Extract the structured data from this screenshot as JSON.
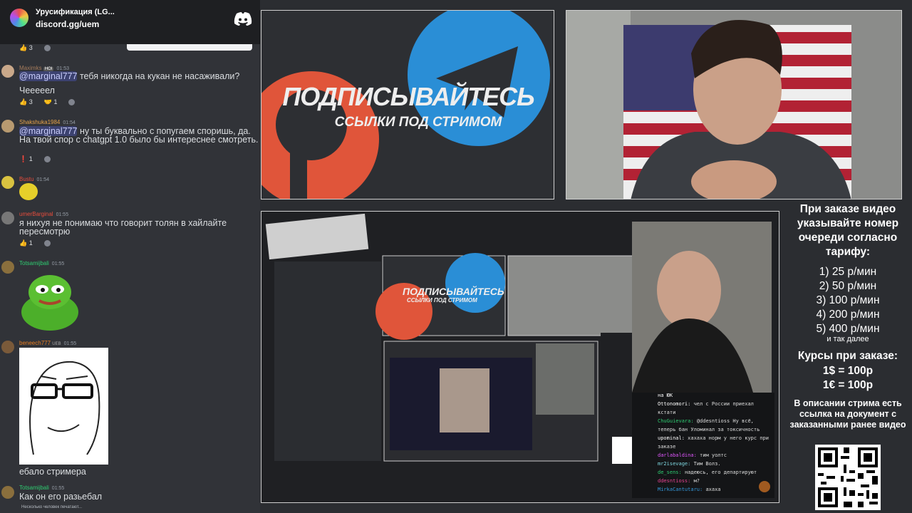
{
  "discord": {
    "server_title": "Урусификация (LG...",
    "invite_url": "discord.gg/uem",
    "messages": [
      {
        "user": "Maximks",
        "badge": "HOI",
        "time": "01:53",
        "mention": "@marginal777",
        "text": " тебя никогда на кукан не насаживали?",
        "text2": "Чееееел",
        "reactions": [
          "3",
          "1"
        ]
      },
      {
        "user": "Shakshuka1984",
        "time": "01:54",
        "mention": "@marginal777",
        "text": " ну ты буквально с попугаем споришь, да. На твой спор с chatgpt 1.0 было бы интереснее смотреть.",
        "reactions": [
          "1"
        ]
      },
      {
        "user": "Bustu",
        "time": "01:54"
      },
      {
        "user": "umerBarginal",
        "time": "01:55",
        "text": "я нихуя не понимаю что говорит толян в хайлайте пересмотрю",
        "reactions": [
          "1"
        ]
      },
      {
        "user": "Totsamijbali",
        "time": "01:55"
      },
      {
        "user": "beneech777",
        "badge": "UEB",
        "time": "01:55",
        "text": "ебало стримера"
      },
      {
        "user": "Totsamijbali",
        "time": "01:55",
        "text": "Как он его разьебал"
      }
    ],
    "top_reactions": [
      "3"
    ],
    "typing": "Несколько человек печатают..."
  },
  "banner": {
    "title": "ПОДПИСЫВАЙТЕСЬ",
    "subtitle": "ССЫЛКИ ПОД СТРИМОМ"
  },
  "inner_chat": [
    {
      "user": "на ЮК",
      "text": ""
    },
    {
      "user": "Ottonomori:",
      "text": "чел с России приехал кстати"
    },
    {
      "user": "ChuGuievara:",
      "text": "@ddesntioss Ну всё, теперь бан Уломинал за токсичность"
    },
    {
      "user": "upominal:",
      "text": "хахаха норм у него курс при заказе"
    },
    {
      "user": "darlabaldina:",
      "text": "тим уолтс"
    },
    {
      "user": "mr2isevage:",
      "text": "Тим Волз."
    },
    {
      "user": "de_sens:",
      "text": "надеюсь, его департируют"
    },
    {
      "user": "ddesntioss:",
      "text": "м?"
    },
    {
      "user": "MirkaCantutaru:",
      "text": "ахаха"
    }
  ],
  "info": {
    "heading": "При заказе видео указывайте номер очереди согласно тарифу:",
    "tariffs": [
      "1) 25 р/мин",
      "2) 50 р/мин",
      "3) 100 р/мин",
      "4) 200 р/мин",
      "5) 400 р/мин"
    ],
    "etc": "и так далее",
    "courses_title": "Курсы при заказе:",
    "course_usd": "1$ = 100р",
    "course_eur": "1€ = 100р",
    "doc_note": "В описании стрима есть ссылка на документ с заказанными ранее видео"
  },
  "colors": {
    "discord_bg": "#313338",
    "accent": "#5865f2",
    "banner_red": "#e0553a",
    "banner_blue": "#2a8ed6"
  }
}
